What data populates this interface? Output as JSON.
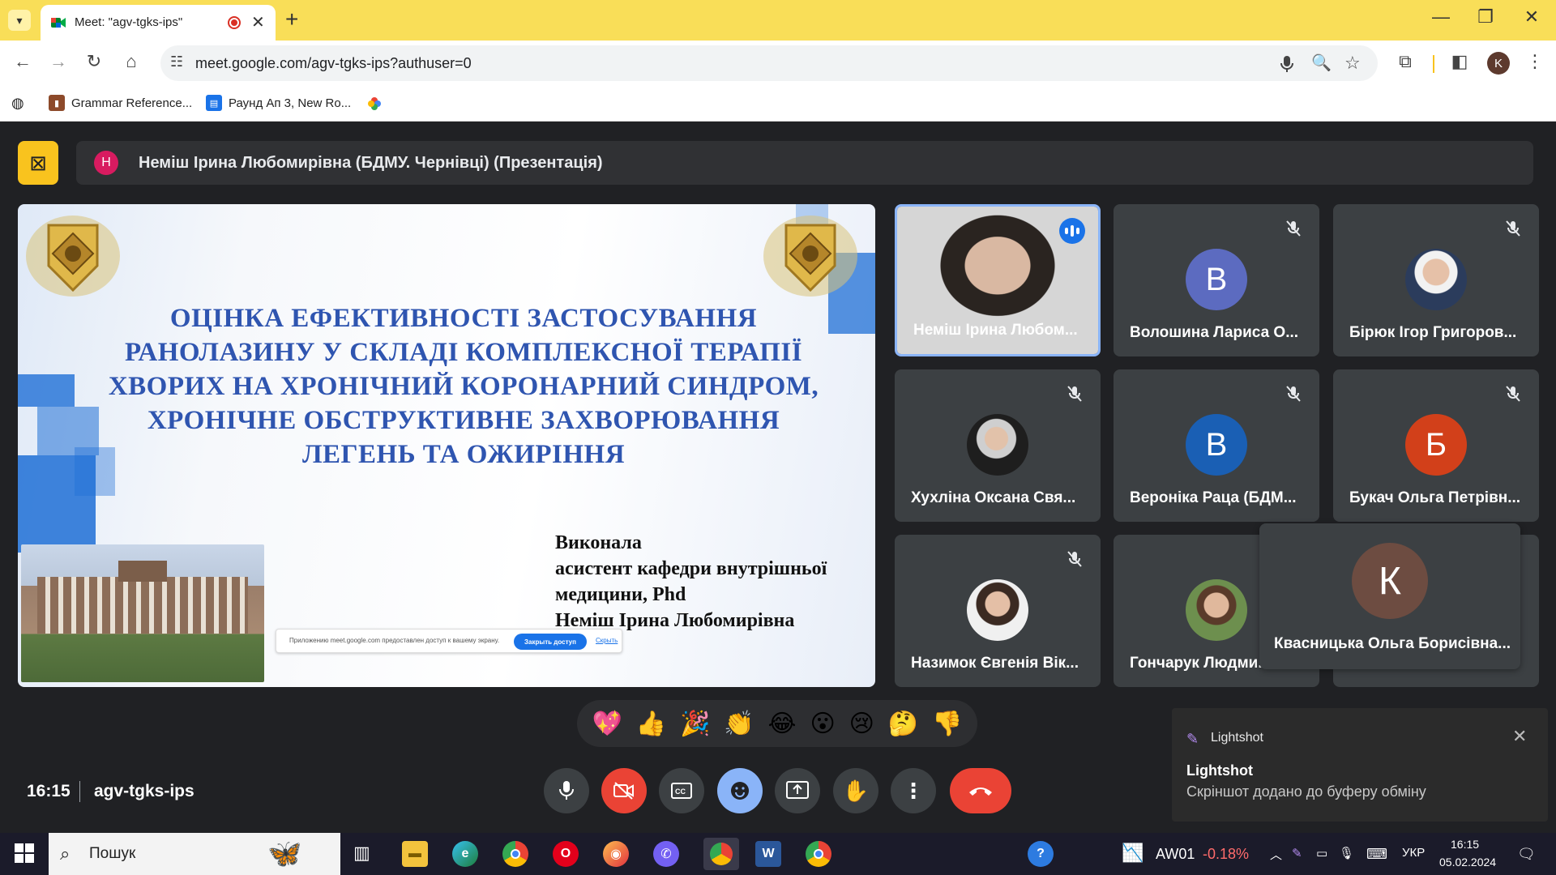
{
  "browser": {
    "tab_title": "Meet: \"agv-tgks-ips\"",
    "url": "meet.google.com/agv-tgks-ips?authuser=0",
    "profile_initial": "K",
    "bookmarks": [
      {
        "label": "Grammar Reference..."
      },
      {
        "label": "Раунд Ап 3, New Ro..."
      }
    ]
  },
  "presentation": {
    "avatar_initial": "Н",
    "presenter_name": "Неміш Ірина Любомирівна (БДМУ. Чернівці) (Презентація)"
  },
  "slide": {
    "title_lines": [
      "ОЦІНКА ЕФЕКТИВНОСТІ ЗАСТОСУВАННЯ",
      "РАНОЛАЗИНУ У СКЛАДІ КОМПЛЕКСНОЇ ТЕРАПІЇ",
      "ХВОРИХ НА ХРОНІЧНИЙ КОРОНАРНИЙ СИНДРОМ,",
      "ХРОНІЧНЕ ОБСТРУКТИВНЕ ЗАХВОРЮВАННЯ",
      "ЛЕГЕНЬ ТА ОЖИРІННЯ"
    ],
    "author_lines": [
      "Виконала",
      "асистент кафедри внутрішньої",
      "медицини, Phd",
      "Неміш Ірина Любомирівна"
    ],
    "share_notice": {
      "text": "Приложению meet.google.com предоставлен доступ к вашему экрану.",
      "stop": "Закрыть доступ",
      "hide": "Скрыть"
    }
  },
  "participants": [
    {
      "name": "Неміш Ірина Любом...",
      "initial": "",
      "color": "",
      "muted": false,
      "speaking": true,
      "photo": true
    },
    {
      "name": "Волошина Лариса О...",
      "initial": "В",
      "color": "#5c6bc0",
      "muted": true,
      "photo": false
    },
    {
      "name": "Бірюк Ігор Григоров...",
      "initial": "",
      "color": "",
      "muted": true,
      "photo": true
    },
    {
      "name": "Хухліна Оксана Свя...",
      "initial": "",
      "color": "",
      "muted": true,
      "photo": true
    },
    {
      "name": "Вероніка Раца (БДМ...",
      "initial": "В",
      "color": "#1a5fb4",
      "muted": true,
      "photo": false
    },
    {
      "name": "Букач Ольга Петрівн...",
      "initial": "Б",
      "color": "#d2401a",
      "muted": true,
      "photo": false
    },
    {
      "name": "Назимок Євгенія Вік...",
      "initial": "",
      "color": "",
      "muted": true,
      "photo": true
    },
    {
      "name": "Гончарук Людми...",
      "initial": "",
      "color": "",
      "muted": false,
      "photo": true
    }
  ],
  "popup_participant": {
    "name": "Квасницька Ольга Борисівна...",
    "initial": "К",
    "color": "#6d4c41"
  },
  "reactions": [
    "💖",
    "👍",
    "🎉",
    "👏",
    "😂",
    "😮",
    "😢",
    "🤔",
    "👎"
  ],
  "meeting": {
    "time": "16:15",
    "code": "agv-tgks-ips"
  },
  "lightshot": {
    "app": "Lightshot",
    "title": "Lightshot",
    "message": "Скріншот додано до буферу обміну"
  },
  "taskbar": {
    "search_placeholder": "Пошук",
    "stock_symbol": "AW01",
    "stock_change": "-0.18%",
    "language": "УКР",
    "time": "16:15",
    "date": "05.02.2024"
  }
}
